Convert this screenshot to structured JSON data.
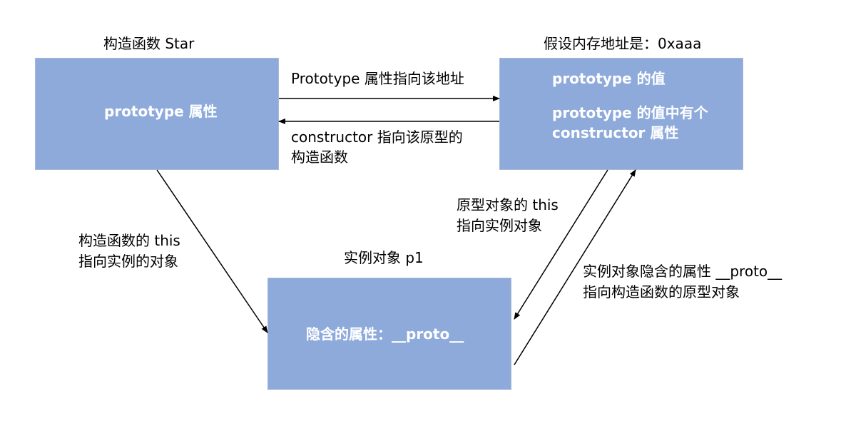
{
  "colors": {
    "box_fill": "#8eaadb",
    "box_text": "#ffffff",
    "arrow": "#000000",
    "background": "#ffffff"
  },
  "constructor_box": {
    "title": "构造函数 Star",
    "content": "prototype 属性"
  },
  "prototype_box": {
    "title": "假设内存地址是：0xaaa",
    "line1": "prototype 的值",
    "line2": "prototype 的值中有个",
    "line3": "constructor 属性"
  },
  "instance_box": {
    "title": "实例对象 p1",
    "content": "隐含的属性：__proto__"
  },
  "arrow_labels": {
    "prototype_points_to": "Prototype 属性指向该地址",
    "constructor_points_to_line1": "constructor 指向该原型的",
    "constructor_points_to_line2": "构造函数",
    "constructor_this_line1": "构造函数的 this",
    "constructor_this_line2": "指向实例的对象",
    "prototype_this_line1": "原型对象的 this",
    "prototype_this_line2": "指向实例对象",
    "proto_link_line1": "实例对象隐含的属性 __proto__",
    "proto_link_line2": "指向构造函数的原型对象"
  }
}
